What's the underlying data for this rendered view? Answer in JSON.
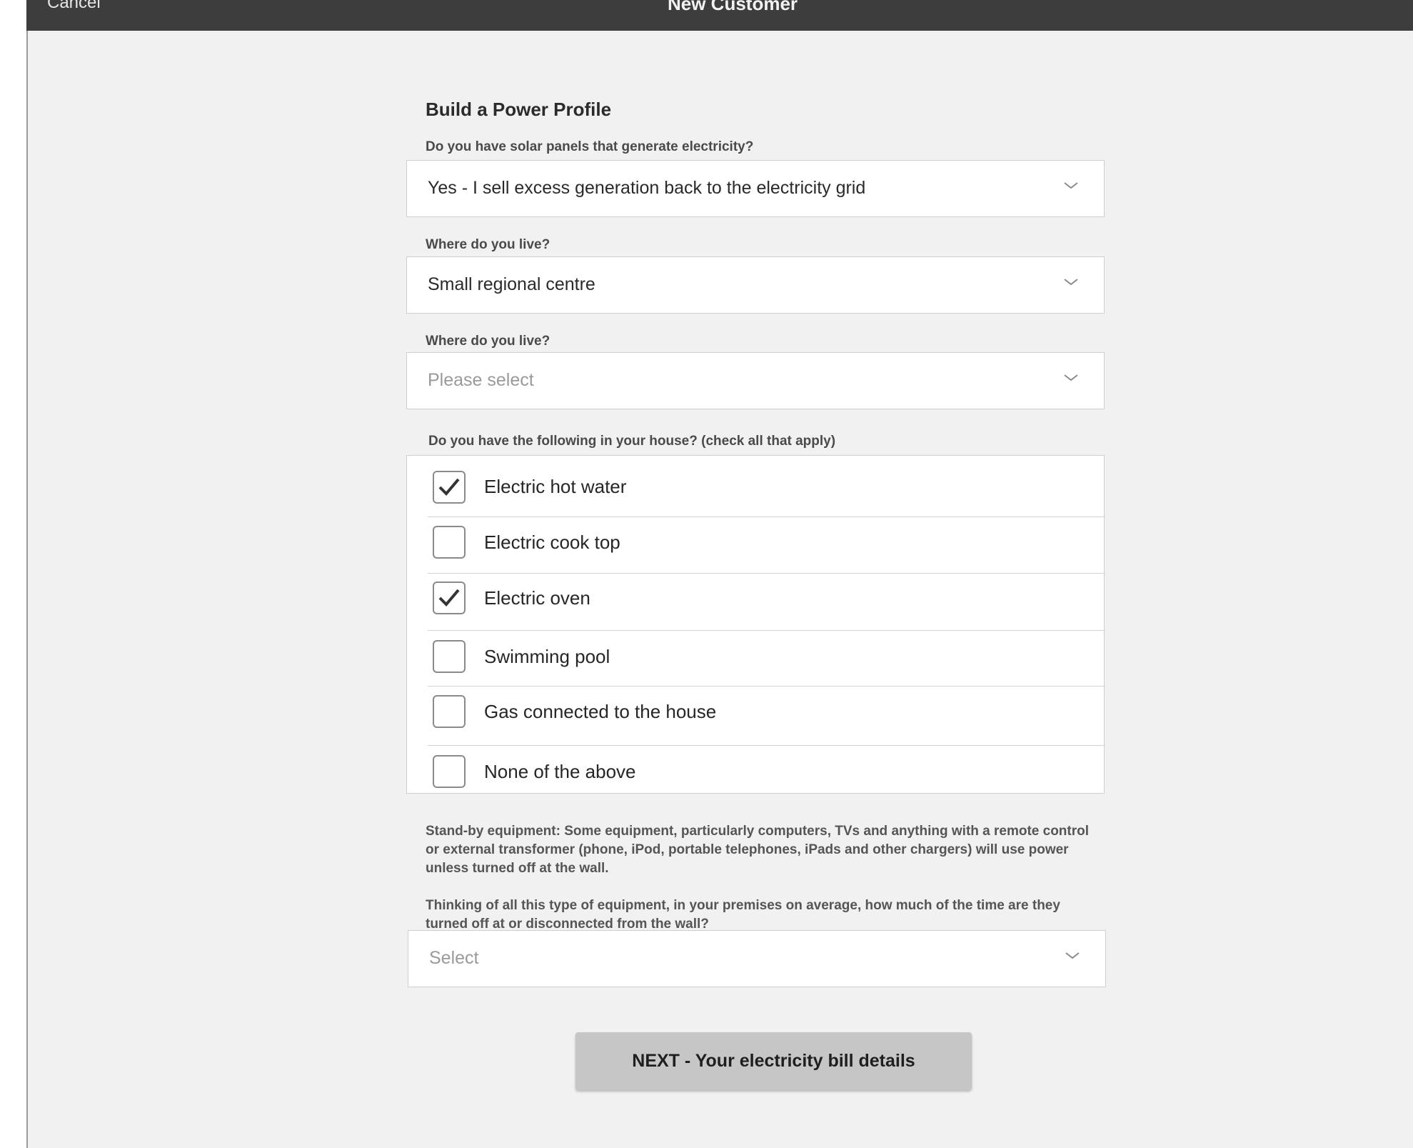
{
  "header": {
    "cancel_label": "Cancel",
    "title": "New Customer"
  },
  "form": {
    "section_title": "Build a Power Profile",
    "solar": {
      "label": "Do you have solar panels that generate electricity?",
      "value": "Yes - I sell excess generation back to the electricity grid"
    },
    "location": {
      "label": "Where do you live?",
      "value": "Small regional centre"
    },
    "location2": {
      "label": "Where do you live?",
      "placeholder": "Please select"
    },
    "appliances": {
      "label": "Do you have the following in your house? (check all that apply)",
      "items": [
        {
          "label": "Electric hot water",
          "checked": true
        },
        {
          "label": "Electric cook top",
          "checked": false
        },
        {
          "label": "Electric oven",
          "checked": true
        },
        {
          "label": "Swimming pool",
          "checked": false
        },
        {
          "label": "Gas connected to the house",
          "checked": false
        },
        {
          "label": "None of the above",
          "checked": false
        }
      ]
    },
    "standby_note": "Stand-by equipment: Some equipment, particularly computers, TVs and anything with a remote control or external transformer (phone, iPod, portable telephones, iPads and other chargers) will use power unless turned off at the wall.",
    "standby_question": "Thinking of all this type of equipment, in your premises on average, how much of the time are they turned off at or disconnected from the wall?",
    "standby_select": {
      "placeholder": "Select"
    },
    "next_label": "NEXT - Your electricity bill details"
  },
  "icons": {
    "dropdown": "chevron-down-icon",
    "check": "checkmark-icon"
  },
  "colors": {
    "header_bg": "#3d3d3d",
    "page_bg": "#f1f1f1",
    "button_bg": "#c6c6c6"
  }
}
